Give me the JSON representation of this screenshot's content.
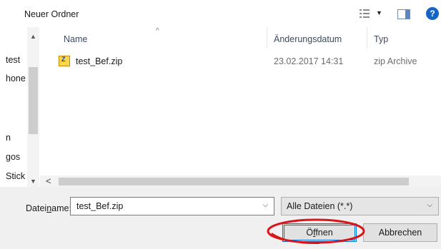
{
  "toolbar": {
    "new_folder": "Neuer Ordner",
    "view_icon": "view-options-icon",
    "caret": "▼",
    "pane_icon": "preview-pane-icon",
    "help": "?"
  },
  "nav": {
    "items": [
      "test",
      "hone",
      "n",
      "gos",
      "Stick"
    ],
    "scroll_up": "▲",
    "scroll_down": "▼"
  },
  "columns": {
    "name": "Name",
    "date": "Änderungsdatum",
    "type": "Typ",
    "sort_arrow": "^"
  },
  "files": [
    {
      "name": "test_Bef.zip",
      "date": "23.02.2017 14:31",
      "type": "zip Archive",
      "icon": "zip-file-icon"
    }
  ],
  "hscroll": {
    "left": "<"
  },
  "form": {
    "filename_label_pre": "Datei",
    "filename_label_ul": "n",
    "filename_label_post": "ame:",
    "filename_value": "test_Bef.zip",
    "filetype_value": "Alle Dateien (*.*)",
    "dropdown_caret": "⌵"
  },
  "buttons": {
    "open_pre": "Ö",
    "open_ul": "f",
    "open_post": "fnen",
    "cancel": "Abbrechen"
  },
  "colors": {
    "highlight": "#d9141b",
    "accent": "#0078d7"
  }
}
